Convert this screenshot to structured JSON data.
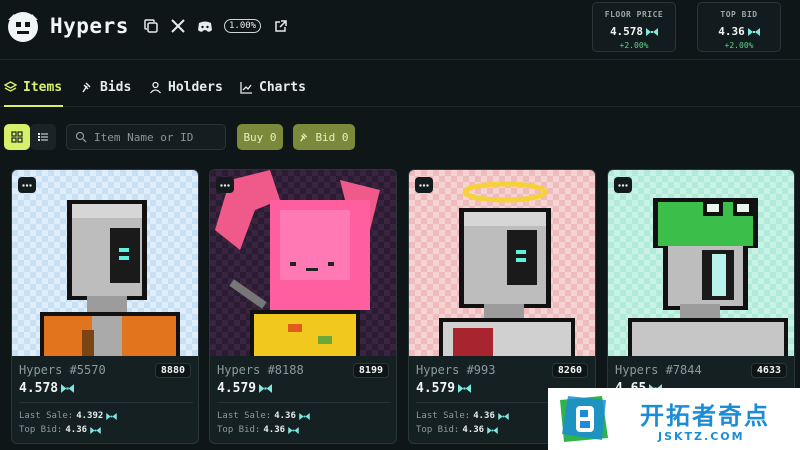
{
  "app": {
    "title": "Hypers",
    "royalty_badge": "1.00%"
  },
  "icons": {
    "copy": "copy-icon",
    "x": "x-twitter-icon",
    "discord": "discord-icon",
    "external": "external-link-icon",
    "eth": "bowtie-currency-icon"
  },
  "stats": [
    {
      "label": "FLOOR PRICE",
      "value": "4.578",
      "change": "+2.00%"
    },
    {
      "label": "TOP BID",
      "value": "4.36",
      "change": "+2.00%"
    }
  ],
  "tabs": [
    {
      "label": "Items",
      "active": true
    },
    {
      "label": "Bids",
      "active": false
    },
    {
      "label": "Holders",
      "active": false
    },
    {
      "label": "Charts",
      "active": false
    }
  ],
  "toolbar": {
    "search_placeholder": "Item Name or ID",
    "buy_label": "Buy 0",
    "bid_label": "Bid 0"
  },
  "labels": {
    "last_sale": "Last Sale:",
    "top_bid": "Top Bid:"
  },
  "cards": [
    {
      "name": "Hypers #5570",
      "id": "8880",
      "price": "4.578",
      "last_sale": "4.392",
      "top_bid": "4.36"
    },
    {
      "name": "Hypers #8188",
      "id": "8199",
      "price": "4.579",
      "last_sale": "4.36",
      "top_bid": "4.36"
    },
    {
      "name": "Hypers #993",
      "id": "8260",
      "price": "4.579",
      "last_sale": "4.36",
      "top_bid": "4.36"
    },
    {
      "name": "Hypers #7844",
      "id": "4633",
      "price": "4.65",
      "last_sale": "",
      "top_bid": ""
    }
  ],
  "watermark": {
    "text": "开拓者奇点",
    "sub": "JSKTZ.COM"
  },
  "colors": {
    "accent": "#d6f06a",
    "positive": "#5fd38a",
    "currency": "#7ee8e0",
    "background": "#0f1618"
  }
}
